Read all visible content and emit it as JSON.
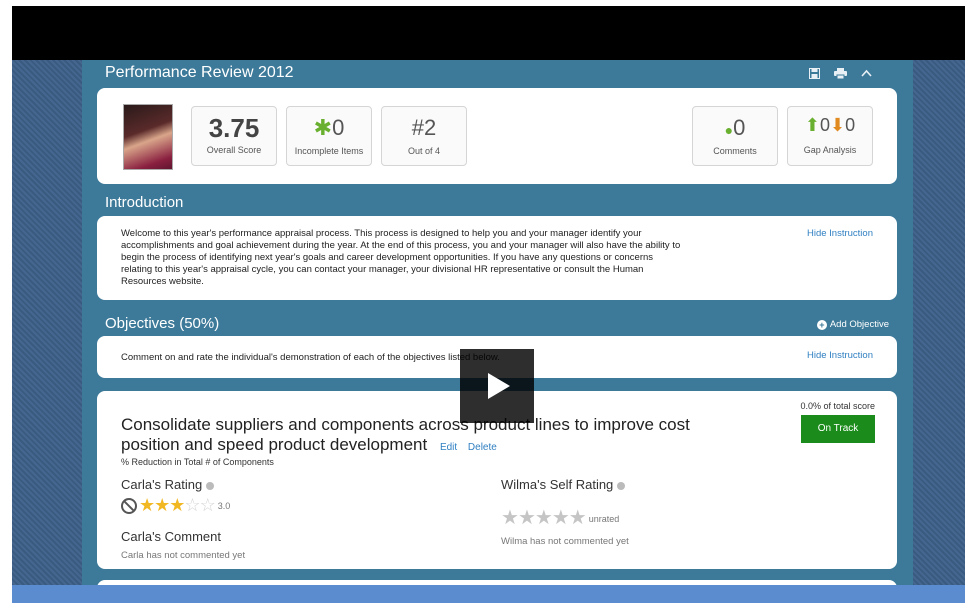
{
  "review": {
    "title": "Performance Review 2012",
    "tools": [
      "save-icon",
      "print-icon",
      "collapse-icon"
    ],
    "overall": {
      "value": "3.75",
      "label": "Overall Score"
    },
    "incomplete": {
      "value": "0",
      "label": "Incomplete Items"
    },
    "rank": {
      "value": "#2",
      "label": "Out of 4"
    },
    "comments": {
      "value": "0",
      "label": "Comments"
    },
    "gap": {
      "up": "0",
      "down": "0",
      "label": "Gap Analysis"
    }
  },
  "introduction": {
    "title": "Introduction",
    "text": "Welcome to this year's performance appraisal process. This process is designed to help you and your manager identify your accomplishments and goal achievement during the year. At the end of this process, you and your manager will also have the ability to begin the process of identifying next year's goals and career development opportunities. If you have any questions or concerns relating to this year's appraisal cycle, you can contact your manager, your divisional HR representative or consult the Human Resources website.",
    "hide_label": "Hide Instruction"
  },
  "objectives": {
    "title": "Objectives (50%)",
    "add_label": "Add Objective",
    "instruction": "Comment on and rate the individual's demonstration of each of the objectives listed below.",
    "hide_label": "Hide Instruction"
  },
  "objective_item": {
    "title": "Consolidate suppliers and components across product lines to improve cost position and speed product development",
    "edit_label": "Edit",
    "delete_label": "Delete",
    "metric": "% Reduction in Total # of Components",
    "total_score": "0.0% of total score",
    "status": "On Track",
    "manager_rating_label": "Carla's Rating",
    "manager_rating_value": "3.0",
    "manager_stars": 3,
    "self_rating_label": "Wilma's Self Rating",
    "self_rating_value": "unrated",
    "manager_comment_label": "Carla's Comment",
    "manager_comment_empty": "Carla has not commented yet",
    "self_comment_empty": "Wilma has not commented yet"
  },
  "colors": {
    "accent": "#3d7a99",
    "link": "#2f7fc1",
    "status": "#1b8c1b",
    "star": "#f2b824"
  }
}
